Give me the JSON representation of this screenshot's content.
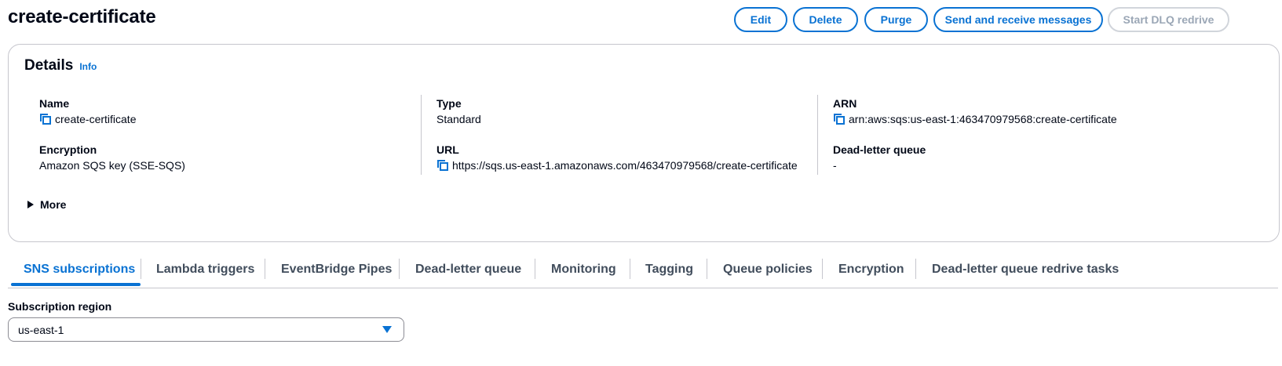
{
  "page": {
    "title": "create-certificate"
  },
  "actions": {
    "edit": "Edit",
    "delete": "Delete",
    "purge": "Purge",
    "send_receive": "Send and receive messages",
    "start_dlq_redrive": "Start DLQ redrive"
  },
  "details": {
    "title": "Details",
    "info": "Info",
    "name_label": "Name",
    "name_value": "create-certificate",
    "type_label": "Type",
    "type_value": "Standard",
    "arn_label": "ARN",
    "arn_value": "arn:aws:sqs:us-east-1:463470979568:create-certificate",
    "encryption_label": "Encryption",
    "encryption_value": "Amazon SQS key (SSE-SQS)",
    "url_label": "URL",
    "url_value": "https://sqs.us-east-1.amazonaws.com/463470979568/create-certificate",
    "dlq_label": "Dead-letter queue",
    "dlq_value": "-",
    "more": "More"
  },
  "tabs": [
    {
      "label": "SNS subscriptions",
      "active": true
    },
    {
      "label": "Lambda triggers"
    },
    {
      "label": "EventBridge Pipes"
    },
    {
      "label": "Dead-letter queue"
    },
    {
      "label": "Monitoring"
    },
    {
      "label": "Tagging"
    },
    {
      "label": "Queue policies"
    },
    {
      "label": "Encryption"
    },
    {
      "label": "Dead-letter queue redrive tasks"
    }
  ],
  "subscription": {
    "region_label": "Subscription region",
    "region_value": "us-east-1"
  },
  "colors": {
    "accent": "#0972d3",
    "text": "#000716",
    "border": "#c6c6cd",
    "disabled": "#9ba7b6"
  },
  "icons": {
    "copy": "copy-icon",
    "more_caret": "caret-right-icon",
    "select_caret": "caret-down-icon"
  }
}
